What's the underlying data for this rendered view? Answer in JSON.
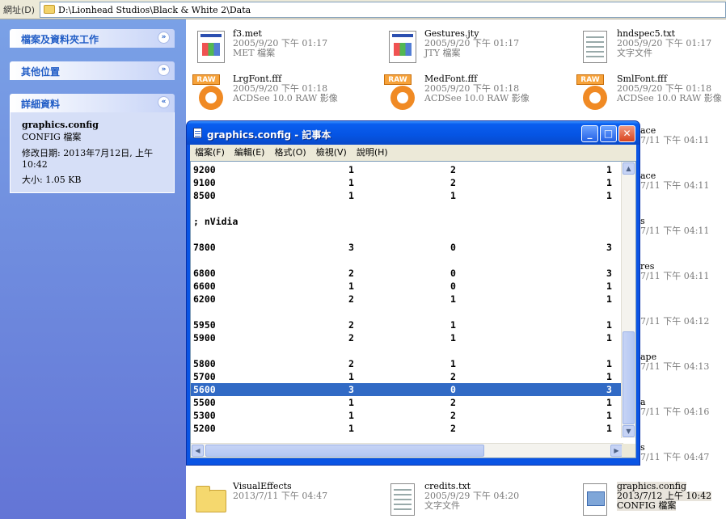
{
  "address_bar": {
    "label": "網址(D)",
    "path": "D:\\Lionhead Studios\\Black & White 2\\Data"
  },
  "tasks": [
    {
      "title": "檔案及資料夾工作",
      "chevron": "»"
    },
    {
      "title": "其他位置",
      "chevron": "»"
    },
    {
      "title": "詳細資料",
      "chevron": "«"
    }
  ],
  "details": {
    "name": "graphics.config",
    "type": "CONFIG 檔案",
    "modified": "修改日期: 2013年7月12日, 上午 10:42",
    "size": "大小: 1.05 KB"
  },
  "files": [
    {
      "icon": "win-app-icon",
      "name": "f3.met",
      "date": "2005/9/20 下午 01:17",
      "type": "MET 檔案"
    },
    {
      "icon": "win-app-icon",
      "name": "Gestures.jty",
      "date": "2005/9/20 下午 01:17",
      "type": "JTY 檔案"
    },
    {
      "icon": "text-doc-icon",
      "name": "hndspec5.txt",
      "date": "2005/9/20 下午 01:17",
      "type": "文字文件"
    },
    {
      "icon": "raw-image-icon",
      "name": "LrgFont.fff",
      "date": "2005/9/20 下午 01:18",
      "type": "ACDSee 10.0 RAW 影像"
    },
    {
      "icon": "raw-image-icon",
      "name": "MedFont.fff",
      "date": "2005/9/20 下午 01:18",
      "type": "ACDSee 10.0 RAW 影像"
    },
    {
      "icon": "raw-image-icon",
      "name": "SmlFont.fff",
      "date": "2005/9/20 下午 01:18",
      "type": "ACDSee 10.0 RAW 影像"
    },
    {
      "icon": "folder-icon",
      "name": "VisualEffects",
      "date": "2013/7/11 下午 04:47",
      "type": ""
    },
    {
      "icon": "text-doc-icon",
      "name": "credits.txt",
      "date": "2005/9/29 下午 04:20",
      "type": "文字文件"
    },
    {
      "icon": "config-file-icon",
      "name": "graphics.config",
      "date": "2013/7/12 上午 10:42",
      "type": "CONFIG 檔案"
    }
  ],
  "partial_right": [
    {
      "name": "ace",
      "date": "7/11 下午 04:11"
    },
    {
      "name": "ace",
      "date": "7/11 下午 04:11"
    },
    {
      "name": "s",
      "date": "7/11 下午 04:11"
    },
    {
      "name": "res",
      "date": "7/11 下午 04:11"
    },
    {
      "name": "",
      "date": "7/11 下午 04:12"
    },
    {
      "name": "ape",
      "date": "7/11 下午 04:13"
    },
    {
      "name": "a",
      "date": "7/11 下午 04:16"
    },
    {
      "name": "s",
      "date": "7/11 下午 04:47"
    }
  ],
  "notepad": {
    "title": "graphics.config - 記事本",
    "buttons": [
      "_",
      "□",
      "✕"
    ],
    "menu": [
      "檔案(F)",
      "編輯(E)",
      "格式(O)",
      "檢視(V)",
      "說明(H)"
    ],
    "lines": [
      [
        "9200",
        "1",
        "2",
        "1"
      ],
      [
        "9100",
        "1",
        "2",
        "1"
      ],
      [
        "8500",
        "1",
        "1",
        "1"
      ],
      [
        "",
        "",
        "",
        ""
      ],
      [
        "; nVidia",
        "",
        "",
        ""
      ],
      [
        "",
        "",
        "",
        ""
      ],
      [
        "7800",
        "3",
        "0",
        "3"
      ],
      [
        "",
        "",
        "",
        ""
      ],
      [
        "6800",
        "2",
        "0",
        "3"
      ],
      [
        "6600",
        "1",
        "0",
        "1"
      ],
      [
        "6200",
        "2",
        "1",
        "1"
      ],
      [
        "",
        "",
        "",
        ""
      ],
      [
        "5950",
        "2",
        "1",
        "1"
      ],
      [
        "5900",
        "2",
        "1",
        "1"
      ],
      [
        "",
        "",
        "",
        ""
      ],
      [
        "5800",
        "2",
        "1",
        "1"
      ],
      [
        "5700",
        "1",
        "2",
        "1"
      ],
      [
        "5600",
        "3",
        "0",
        "3"
      ],
      [
        "5500",
        "1",
        "2",
        "1"
      ],
      [
        "5300",
        "1",
        "2",
        "1"
      ],
      [
        "5200",
        "1",
        "2",
        "1"
      ]
    ],
    "selected_line": 17
  }
}
